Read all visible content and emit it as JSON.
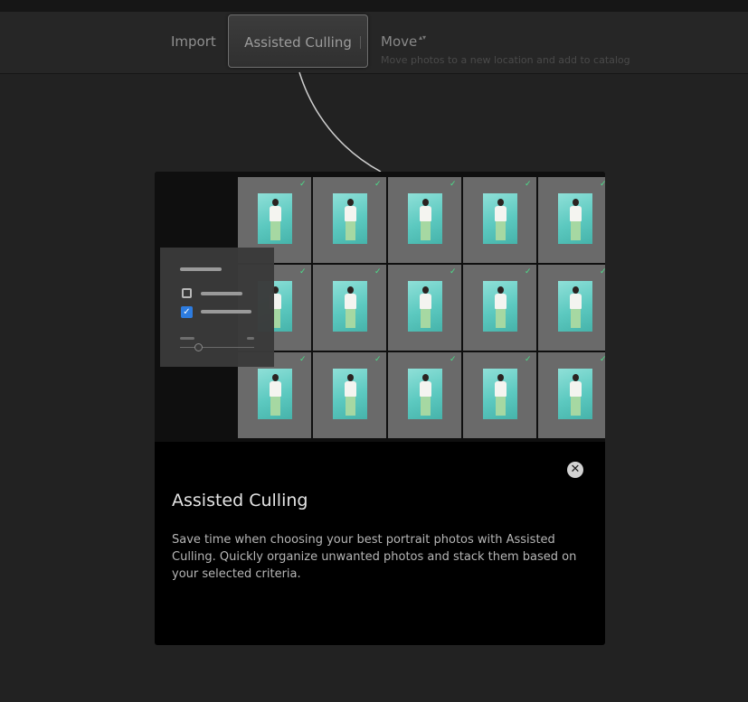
{
  "modebar": {
    "import_label": "Import",
    "culling_label": "Assisted Culling",
    "move_label": "Move",
    "move_caret": "▴▾",
    "move_subtitle": "Move photos to a new location and add to catalog"
  },
  "coachmark": {
    "title": "Assisted Culling",
    "body": "Save time when choosing your best portrait photos with Assisted Culling. Quickly organize unwanted photos and stack them based on your selected criteria.",
    "close_glyph": "✕",
    "checkmark_glyph": "✓",
    "checkbox_checked_glyph": "✓"
  },
  "colors": {
    "check_green": "#4be08a",
    "checkbox_blue": "#2d7ce0",
    "photo_backdrop": "#5cc9c0"
  },
  "thumbnails": {
    "rows": 3,
    "columns": 5,
    "all_checked": true
  }
}
